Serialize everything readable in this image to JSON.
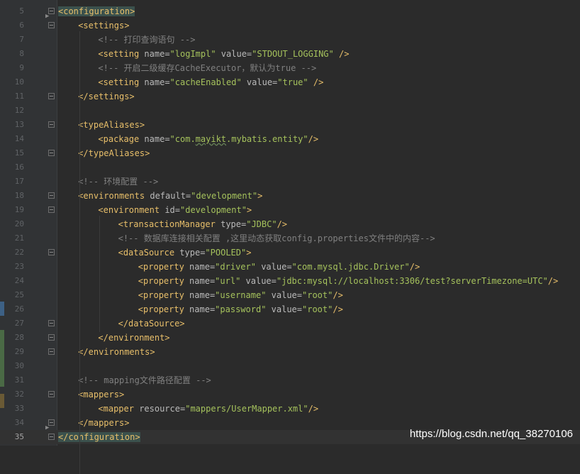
{
  "editor": {
    "lines": [
      {
        "n": "5",
        "fold": true,
        "indent": 0,
        "parts": [
          [
            "hl",
            "<configuration>"
          ]
        ]
      },
      {
        "n": "6",
        "fold": true,
        "indent": 1,
        "parts": [
          [
            "b",
            "<settings>"
          ]
        ]
      },
      {
        "n": "7",
        "fold": false,
        "indent": 2,
        "parts": [
          [
            "c",
            "<!-- 打印查询语句 -->"
          ]
        ]
      },
      {
        "n": "8",
        "fold": false,
        "indent": 2,
        "parts": [
          [
            "b",
            "<setting "
          ],
          [
            "a",
            "name="
          ],
          [
            "v",
            "\"logImpl\""
          ],
          [
            "a",
            " value="
          ],
          [
            "v",
            "\"STDOUT_LOGGING\""
          ],
          [
            "b",
            " />"
          ]
        ]
      },
      {
        "n": "9",
        "fold": false,
        "indent": 2,
        "parts": [
          [
            "c",
            "<!-- 开启二级缓存CacheExecutor，默认为true -->"
          ]
        ]
      },
      {
        "n": "10",
        "fold": false,
        "indent": 2,
        "parts": [
          [
            "b",
            "<setting "
          ],
          [
            "a",
            "name="
          ],
          [
            "v",
            "\"cacheEnabled\""
          ],
          [
            "a",
            " value="
          ],
          [
            "v",
            "\"true\""
          ],
          [
            "b",
            " />"
          ]
        ]
      },
      {
        "n": "11",
        "fold": true,
        "indent": 1,
        "parts": [
          [
            "b",
            "</settings>"
          ]
        ]
      },
      {
        "n": "12",
        "fold": false,
        "indent": 0,
        "parts": []
      },
      {
        "n": "13",
        "fold": true,
        "indent": 1,
        "parts": [
          [
            "b",
            "<typeAliases>"
          ]
        ]
      },
      {
        "n": "14",
        "fold": false,
        "indent": 2,
        "parts": [
          [
            "b",
            "<package "
          ],
          [
            "a",
            "name="
          ],
          [
            "v",
            "\"com."
          ],
          [
            "vt",
            "mayikt"
          ],
          [
            "v",
            ".mybatis.entity\""
          ],
          [
            "b",
            "/>"
          ]
        ]
      },
      {
        "n": "15",
        "fold": true,
        "indent": 1,
        "parts": [
          [
            "b",
            "</typeAliases>"
          ]
        ]
      },
      {
        "n": "16",
        "fold": false,
        "indent": 0,
        "parts": []
      },
      {
        "n": "17",
        "fold": false,
        "indent": 1,
        "parts": [
          [
            "c",
            "<!-- 环境配置 -->"
          ]
        ]
      },
      {
        "n": "18",
        "fold": true,
        "indent": 1,
        "parts": [
          [
            "b",
            "<environments "
          ],
          [
            "a",
            "default="
          ],
          [
            "v",
            "\"development\""
          ],
          [
            "b",
            ">"
          ]
        ]
      },
      {
        "n": "19",
        "fold": true,
        "indent": 2,
        "parts": [
          [
            "b",
            "<environment "
          ],
          [
            "a",
            "id="
          ],
          [
            "v",
            "\"development\""
          ],
          [
            "b",
            ">"
          ]
        ]
      },
      {
        "n": "20",
        "fold": false,
        "indent": 3,
        "parts": [
          [
            "b",
            "<transactionManager "
          ],
          [
            "a",
            "type="
          ],
          [
            "v",
            "\"JDBC\""
          ],
          [
            "b",
            "/>"
          ]
        ]
      },
      {
        "n": "21",
        "fold": false,
        "indent": 3,
        "parts": [
          [
            "c",
            "<!-- 数据库连接相关配置 ,这里动态获取config.properties文件中的内容-->"
          ]
        ]
      },
      {
        "n": "22",
        "fold": true,
        "indent": 3,
        "parts": [
          [
            "b",
            "<dataSource "
          ],
          [
            "a",
            "type="
          ],
          [
            "v",
            "\"POOLED\""
          ],
          [
            "b",
            ">"
          ]
        ]
      },
      {
        "n": "23",
        "fold": false,
        "indent": 4,
        "parts": [
          [
            "b",
            "<property "
          ],
          [
            "a",
            "name="
          ],
          [
            "v",
            "\"driver\""
          ],
          [
            "a",
            " value="
          ],
          [
            "v",
            "\"com.mysql.jdbc.Driver\""
          ],
          [
            "b",
            "/>"
          ]
        ]
      },
      {
        "n": "24",
        "fold": false,
        "indent": 4,
        "parts": [
          [
            "b",
            "<property "
          ],
          [
            "a",
            "name="
          ],
          [
            "v",
            "\"url\""
          ],
          [
            "a",
            " value="
          ],
          [
            "v",
            "\"jdbc:mysql://localhost:3306/test?serverTimezone=UTC\""
          ],
          [
            "b",
            "/>"
          ]
        ]
      },
      {
        "n": "25",
        "fold": false,
        "indent": 4,
        "parts": [
          [
            "b",
            "<property "
          ],
          [
            "a",
            "name="
          ],
          [
            "v",
            "\"username\""
          ],
          [
            "a",
            " value="
          ],
          [
            "v",
            "\"root\""
          ],
          [
            "b",
            "/>"
          ]
        ]
      },
      {
        "n": "26",
        "fold": false,
        "indent": 4,
        "parts": [
          [
            "b",
            "<property "
          ],
          [
            "a",
            "name="
          ],
          [
            "v",
            "\"password\""
          ],
          [
            "a",
            " value="
          ],
          [
            "v",
            "\"root\""
          ],
          [
            "b",
            "/>"
          ]
        ]
      },
      {
        "n": "27",
        "fold": true,
        "indent": 3,
        "parts": [
          [
            "b",
            "</dataSource>"
          ]
        ]
      },
      {
        "n": "28",
        "fold": true,
        "indent": 2,
        "parts": [
          [
            "b",
            "</environment>"
          ]
        ]
      },
      {
        "n": "29",
        "fold": true,
        "indent": 1,
        "parts": [
          [
            "b",
            "</environments>"
          ]
        ]
      },
      {
        "n": "30",
        "fold": false,
        "indent": 0,
        "parts": []
      },
      {
        "n": "31",
        "fold": false,
        "indent": 1,
        "parts": [
          [
            "c",
            "<!-- mapping文件路径配置 -->"
          ]
        ]
      },
      {
        "n": "32",
        "fold": true,
        "indent": 1,
        "parts": [
          [
            "b",
            "<mappers>"
          ]
        ]
      },
      {
        "n": "33",
        "fold": false,
        "indent": 2,
        "parts": [
          [
            "b",
            "<mapper "
          ],
          [
            "a",
            "resource="
          ],
          [
            "v",
            "\"mappers/UserMapper.xml\""
          ],
          [
            "b",
            "/>"
          ]
        ]
      },
      {
        "n": "34",
        "fold": true,
        "indent": 1,
        "parts": [
          [
            "b",
            "</mappers>"
          ]
        ]
      },
      {
        "n": "35",
        "fold": true,
        "indent": 0,
        "parts": [
          [
            "hl",
            "</configuration>"
          ]
        ]
      }
    ],
    "current_line": "35"
  },
  "watermark": "https://blog.csdn.net/qq_38270106",
  "colors": {
    "background": "#2b2b2b",
    "gutter": "#313335",
    "tag": "#e8bf6a",
    "attr": "#bababa",
    "value": "#a5c25c",
    "comment": "#808080",
    "tag_highlight": "#3b514d"
  }
}
